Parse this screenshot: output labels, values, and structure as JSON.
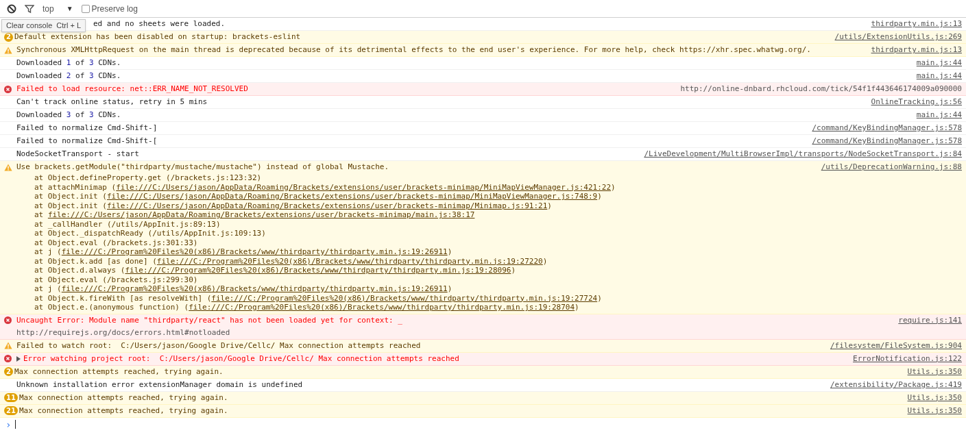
{
  "toolbar": {
    "context": "top",
    "context_arrow": "▼",
    "preserve_log": {
      "label": "Preserve log",
      "checked": false
    }
  },
  "tooltip": {
    "label": "Clear console",
    "shortcut": "Ctrl + L"
  },
  "messages": [
    {
      "kind": "info",
      "parts": [
        {
          "kind": "text",
          "text": "ed and no sheets were loaded."
        }
      ],
      "source": "thirdparty.min.js:13",
      "source_is_link": true
    },
    {
      "kind": "warning",
      "count": "2",
      "parts": [
        {
          "kind": "text",
          "text": "Default extension has been disabled on startup: brackets-eslint"
        }
      ],
      "source": "/utils/ExtensionUtils.js:269",
      "source_is_link": true
    },
    {
      "kind": "warning",
      "parts": [
        {
          "kind": "text",
          "text": "Synchronous XMLHttpRequest on the main thread is deprecated because of its detrimental effects to the end user's experience. For more help, check https://xhr.spec.whatwg.org/."
        }
      ],
      "source": "thirdparty.min.js:13",
      "source_is_link": true
    },
    {
      "kind": "info",
      "parts": [
        {
          "kind": "text",
          "text": "Downloaded "
        },
        {
          "kind": "number",
          "text": "1"
        },
        {
          "kind": "text",
          "text": " of "
        },
        {
          "kind": "number",
          "text": "3"
        },
        {
          "kind": "text",
          "text": " CDNs."
        }
      ],
      "source": "main.js:44",
      "source_is_link": true
    },
    {
      "kind": "info",
      "parts": [
        {
          "kind": "text",
          "text": "Downloaded "
        },
        {
          "kind": "number",
          "text": "2"
        },
        {
          "kind": "text",
          "text": " of "
        },
        {
          "kind": "number",
          "text": "3"
        },
        {
          "kind": "text",
          "text": " CDNs."
        }
      ],
      "source": "main.js:44",
      "source_is_link": true
    },
    {
      "kind": "error",
      "parts": [
        {
          "kind": "text",
          "text": "Failed to load resource: net::ERR_NAME_NOT_RESOLVED"
        }
      ],
      "source": "http://online-dnbard.rhcloud.com/tick/54f1f443646174009a090000",
      "source_is_link": false
    },
    {
      "kind": "info",
      "parts": [
        {
          "kind": "text",
          "text": "Can't track online status, retry in 5 mins"
        }
      ],
      "source": "OnlineTracking.js:56",
      "source_is_link": true
    },
    {
      "kind": "info",
      "parts": [
        {
          "kind": "text",
          "text": "Downloaded "
        },
        {
          "kind": "number",
          "text": "3"
        },
        {
          "kind": "text",
          "text": " of "
        },
        {
          "kind": "number",
          "text": "3"
        },
        {
          "kind": "text",
          "text": " CDNs."
        }
      ],
      "source": "main.js:44",
      "source_is_link": true
    },
    {
      "kind": "info",
      "parts": [
        {
          "kind": "text",
          "text": "Failed to normalize Cmd-Shift-]"
        }
      ],
      "source": "/command/KeyBindingManager.js:578",
      "source_is_link": true
    },
    {
      "kind": "info",
      "parts": [
        {
          "kind": "text",
          "text": "Failed to normalize Cmd-Shift-["
        }
      ],
      "source": "/command/KeyBindingManager.js:578",
      "source_is_link": true
    },
    {
      "kind": "info",
      "parts": [
        {
          "kind": "text",
          "text": "NodeSocketTransport - start"
        }
      ],
      "source": "/LiveDevelopment/MultiBrowserImpl/transports/NodeSocketTransport.js:84",
      "source_is_link": true
    },
    {
      "kind": "warning",
      "parts": [
        {
          "kind": "text",
          "text": "Use brackets.getModule(\"thirdparty/mustache/mustache\") instead of global Mustache."
        }
      ],
      "source": "/utils/DeprecationWarning.js:88",
      "source_is_link": true,
      "stack": [
        {
          "prefix": "at Object.defineProperty.get (/brackets.js:123:32)"
        },
        {
          "prefix": "at attachMinimap (",
          "link": "file:///C:/Users/jason/AppData/Roaming/Brackets/extensions/user/brackets-minimap/MiniMapViewManager.js:421:22",
          "suffix": ")"
        },
        {
          "prefix": "at Object.init (",
          "link": "file:///C:/Users/jason/AppData/Roaming/Brackets/extensions/user/brackets-minimap/MiniMapViewManager.js:748:9",
          "suffix": ")"
        },
        {
          "prefix": "at Object.init (",
          "link": "file:///C:/Users/jason/AppData/Roaming/Brackets/extensions/user/brackets-minimap/Minimap.js:91:21",
          "suffix": ")"
        },
        {
          "prefix": "at ",
          "link": "file:///C:/Users/jason/AppData/Roaming/Brackets/extensions/user/brackets-minimap/main.js:38:17"
        },
        {
          "prefix": "at _callHandler (/utils/AppInit.js:89:13)"
        },
        {
          "prefix": "at Object._dispatchReady (/utils/AppInit.js:109:13)"
        },
        {
          "prefix": "at Object.eval (/brackets.js:301:33)"
        },
        {
          "prefix": "at j (",
          "link": "file:///C:/Program%20Files%20(x86)/Brackets/www/thirdparty/thirdparty.min.js:19:26911",
          "suffix": ")"
        },
        {
          "prefix": "at Object.k.add [as done] (",
          "link": "file:///C:/Program%20Files%20(x86)/Brackets/www/thirdparty/thirdparty.min.js:19:27220",
          "suffix": ")"
        },
        {
          "prefix": "at Object.d.always (",
          "link": "file:///C:/Program%20Files%20(x86)/Brackets/www/thirdparty/thirdparty.min.js:19:28096",
          "suffix": ")"
        },
        {
          "prefix": "at Object.eval (/brackets.js:299:30)"
        },
        {
          "prefix": "at j (",
          "link": "file:///C:/Program%20Files%20(x86)/Brackets/www/thirdparty/thirdparty.min.js:19:26911",
          "suffix": ")"
        },
        {
          "prefix": "at Object.k.fireWith [as resolveWith] (",
          "link": "file:///C:/Program%20Files%20(x86)/Brackets/www/thirdparty/thirdparty.min.js:19:27724",
          "suffix": ")"
        },
        {
          "prefix": "at Object.e.(anonymous function) (",
          "link": "file:///C:/Program%20Files%20(x86)/Brackets/www/thirdparty/thirdparty.min.js:19:28704",
          "suffix": ")"
        }
      ]
    },
    {
      "kind": "error",
      "parts": [
        {
          "kind": "text",
          "text": "Uncaught Error: Module name \"thirdparty/react\" has not been loaded yet for context: _"
        }
      ],
      "detail": "http://requirejs.org/docs/errors.html#notloaded",
      "source": "require.js:141",
      "source_is_link": true
    },
    {
      "kind": "warning",
      "parts": [
        {
          "kind": "text",
          "text": "Failed to watch root:  C:/Users/jason/Google Drive/Cellc/ Max connection attempts reached"
        }
      ],
      "source": "/filesystem/FileSystem.js:904",
      "source_is_link": true
    },
    {
      "kind": "error",
      "expandable": true,
      "expanded": false,
      "parts": [
        {
          "kind": "text",
          "text": "Error watching project root:  C:/Users/jason/Google Drive/Cellc/ Max connection attempts reached"
        }
      ],
      "source": "ErrorNotification.js:122",
      "source_is_link": true
    },
    {
      "kind": "warning",
      "count": "2",
      "parts": [
        {
          "kind": "text",
          "text": "Max connection attempts reached, trying again."
        }
      ],
      "source": "Utils.js:350",
      "source_is_link": true
    },
    {
      "kind": "info",
      "parts": [
        {
          "kind": "text",
          "text": "Unknown installation error extensionManager domain is undefined"
        }
      ],
      "source": "/extensibility/Package.js:419",
      "source_is_link": true
    },
    {
      "kind": "warning",
      "count": "11",
      "parts": [
        {
          "kind": "text",
          "text": "Max connection attempts reached, trying again."
        }
      ],
      "source": "Utils.js:350",
      "source_is_link": true
    },
    {
      "kind": "warning",
      "count": "21",
      "parts": [
        {
          "kind": "text",
          "text": "Max connection attempts reached, trying again."
        }
      ],
      "source": "Utils.js:350",
      "source_is_link": true
    }
  ],
  "prompt": {
    "symbol": "›"
  }
}
